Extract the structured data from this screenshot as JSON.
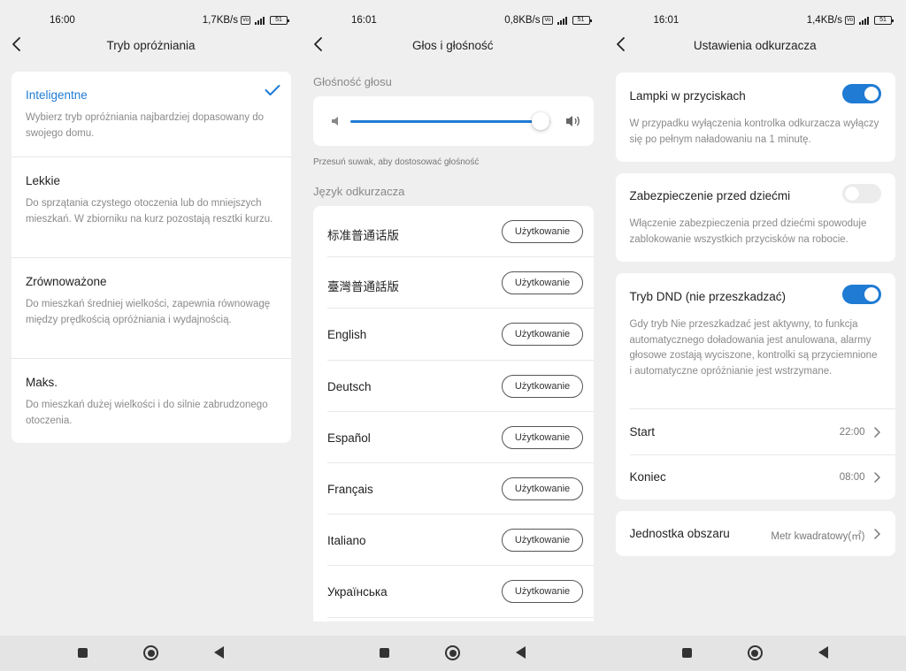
{
  "colors": {
    "accent": "#1f7bd4",
    "background": "#efefef",
    "card": "#ffffff",
    "secondary_text": "#8a8a8a"
  },
  "screen1": {
    "status": {
      "time": "16:00",
      "net": "1,7KB/s",
      "battery": "51"
    },
    "title": "Tryb opróżniania",
    "options": [
      {
        "label": "Inteligentne",
        "desc": "Wybierz tryb opróżniania najbardziej dopasowany do swojego domu.",
        "selected": true
      },
      {
        "label": "Lekkie",
        "desc": "Do sprzątania czystego otoczenia lub do mniejszych mieszkań. W zbiorniku na kurz pozostają resztki kurzu.",
        "selected": false
      },
      {
        "label": "Zrównoważone",
        "desc": "Do mieszkań średniej wielkości, zapewnia równowagę między prędkością opróżniania i wydajnością.",
        "selected": false
      },
      {
        "label": "Maks.",
        "desc": "Do mieszkań dużej wielkości i do silnie zabrudzonego otoczenia.",
        "selected": false
      }
    ]
  },
  "screen2": {
    "status": {
      "time": "16:01",
      "net": "0,8KB/s",
      "battery": "51"
    },
    "title": "Głos i głośność",
    "volume_label": "Głośność głosu",
    "volume_level": 0.95,
    "hint": "Przesuń suwak, aby dostosować głośność",
    "language_label": "Język odkurzacza",
    "use_label": "Użytkowanie",
    "languages": [
      "标准普通话版",
      "臺灣普通話版",
      "English",
      "Deutsch",
      "Español",
      "Français",
      "Italiano",
      "Українська"
    ]
  },
  "screen3": {
    "status": {
      "time": "16:01",
      "net": "1,4KB/s",
      "battery": "51"
    },
    "title": "Ustawienia odkurzacza",
    "button_lights": {
      "title": "Lampki w przyciskach",
      "desc": "W przypadku wyłączenia kontrolka odkurzacza wyłączy się po pełnym naładowaniu na 1 minutę.",
      "on": true
    },
    "child_lock": {
      "title": "Zabezpieczenie przed dziećmi",
      "desc": "Włączenie zabezpieczenia przed dziećmi spowoduje zablokowanie wszystkich przycisków na robocie.",
      "on": false
    },
    "dnd": {
      "title": "Tryb DND (nie przeszkadzać)",
      "desc": "Gdy tryb Nie przeszkadzać jest aktywny, to funkcja automatycznego doładowania jest anulowana, alarmy głosowe zostają wyciszone, kontrolki są przyciemnione i automatyczne opróżnianie jest wstrzymane.",
      "on": true,
      "start_label": "Start",
      "start_value": "22:00",
      "end_label": "Koniec",
      "end_value": "08:00"
    },
    "area_unit": {
      "label": "Jednostka obszaru",
      "value": "Metr kwadratowy(㎡)"
    }
  }
}
